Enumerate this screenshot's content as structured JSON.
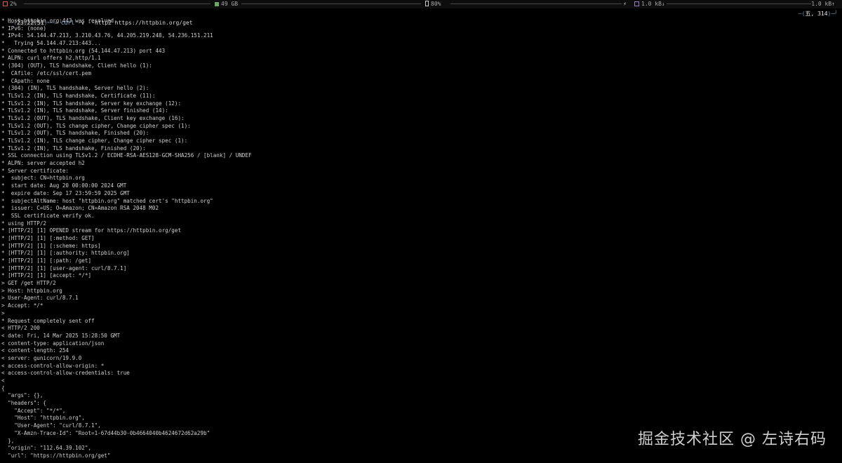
{
  "status_bar": {
    "cpu": "2%",
    "memory": "49 GB",
    "battery": "80%",
    "net_down": "1.0 kB↓",
    "net_up": "1.0 kB↑"
  },
  "prompt": {
    "time": "23:22:51",
    "command": "curl",
    "args": "-v --http2 https://httpbin.org/get",
    "right": "五, 314"
  },
  "output_lines": [
    "* Host httpbin.org:443 was resolved.",
    "* IPv6: (none)",
    "* IPv4: 54.144.47.213, 3.210.43.76, 44.205.219.248, 54.236.151.211",
    "*   Trying 54.144.47.213:443...",
    "* Connected to httpbin.org (54.144.47.213) port 443",
    "* ALPN: curl offers h2,http/1.1",
    "* (304) (OUT), TLS handshake, Client hello (1):",
    "*  CAfile: /etc/ssl/cert.pem",
    "*  CApath: none",
    "* (304) (IN), TLS handshake, Server hello (2):",
    "* TLSv1.2 (IN), TLS handshake, Certificate (11):",
    "* TLSv1.2 (IN), TLS handshake, Server key exchange (12):",
    "* TLSv1.2 (IN), TLS handshake, Server finished (14):",
    "* TLSv1.2 (OUT), TLS handshake, Client key exchange (16):",
    "* TLSv1.2 (OUT), TLS change cipher, Change cipher spec (1):",
    "* TLSv1.2 (OUT), TLS handshake, Finished (20):",
    "* TLSv1.2 (IN), TLS change cipher, Change cipher spec (1):",
    "* TLSv1.2 (IN), TLS handshake, Finished (20):",
    "* SSL connection using TLSv1.2 / ECDHE-RSA-AES128-GCM-SHA256 / [blank] / UNDEF",
    "* ALPN: server accepted h2",
    "* Server certificate:",
    "*  subject: CN=httpbin.org",
    "*  start date: Aug 20 00:00:00 2024 GMT",
    "*  expire date: Sep 17 23:59:59 2025 GMT",
    "*  subjectAltName: host \"httpbin.org\" matched cert's \"httpbin.org\"",
    "*  issuer: C=US; O=Amazon; CN=Amazon RSA 2048 M02",
    "*  SSL certificate verify ok.",
    "* using HTTP/2",
    "* [HTTP/2] [1] OPENED stream for https://httpbin.org/get",
    "* [HTTP/2] [1] [:method: GET]",
    "* [HTTP/2] [1] [:scheme: https]",
    "* [HTTP/2] [1] [:authority: httpbin.org]",
    "* [HTTP/2] [1] [:path: /get]",
    "* [HTTP/2] [1] [user-agent: curl/8.7.1]",
    "* [HTTP/2] [1] [accept: */*]",
    "> GET /get HTTP/2",
    "> Host: httpbin.org",
    "> User-Agent: curl/8.7.1",
    "> Accept: */*",
    ">",
    "* Request completely sent off",
    "< HTTP/2 200",
    "< date: Fri, 14 Mar 2025 15:28:50 GMT",
    "< content-type: application/json",
    "< content-length: 254",
    "< server: gunicorn/19.9.0",
    "< access-control-allow-origin: *",
    "< access-control-allow-credentials: true",
    "<",
    "{",
    "  \"args\": {},",
    "  \"headers\": {",
    "    \"Accept\": \"*/*\",",
    "    \"Host\": \"httpbin.org\",",
    "    \"User-Agent\": \"curl/8.7.1\",",
    "    \"X-Amzn-Trace-Id\": \"Root=1-67d44b30-0b4664040b4624672d62a29b\"",
    "  },",
    "  \"origin\": \"112.64.39.102\",",
    "  \"url\": \"https://httpbin.org/get\""
  ],
  "watermark": "掘金技术社区 @ 左诗右码",
  "colors": {
    "background": "#000000",
    "text": "#d0d0d0",
    "prompt_accent": "#6a8ba8",
    "command": "#8fbfdf",
    "cpu_icon": "#d05a5a",
    "memory_icon": "#6aa86a",
    "battery_icon": "#c8c8c8",
    "network_icon": "#9a7ac8"
  },
  "icons": {
    "cpu": "cpu-icon",
    "memory": "memory-icon",
    "battery": "battery-icon",
    "charging": "bolt-icon",
    "network": "network-icon"
  }
}
